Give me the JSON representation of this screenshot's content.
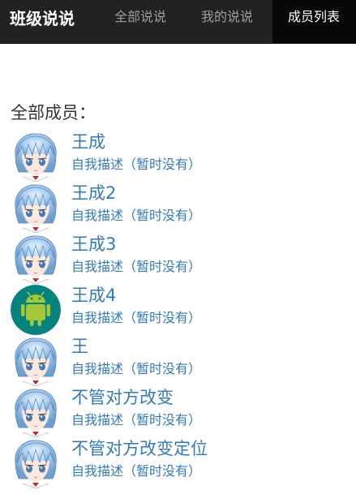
{
  "navbar": {
    "brand": "班级说说",
    "tabs": [
      {
        "label": "全部说说",
        "active": false
      },
      {
        "label": "我的说说",
        "active": false
      },
      {
        "label": "成员列表",
        "active": true
      }
    ]
  },
  "main": {
    "title": "全部成员：",
    "members": [
      {
        "name": "王成",
        "desc": "自我描述（暂时没有）",
        "avatar": "anime-avatar"
      },
      {
        "name": "王成2",
        "desc": "自我描述（暂时没有）",
        "avatar": "anime-avatar"
      },
      {
        "name": "王成3",
        "desc": "自我描述（暂时没有）",
        "avatar": "anime-avatar"
      },
      {
        "name": "王成4",
        "desc": "自我描述（暂时没有）",
        "avatar": "android-avatar"
      },
      {
        "name": "王",
        "desc": "自我描述（暂时没有）",
        "avatar": "anime-avatar"
      },
      {
        "name": "不管对方改变",
        "desc": "自我描述（暂时没有）",
        "avatar": "anime-avatar"
      },
      {
        "name": "不管对方改变定位",
        "desc": "自我描述（暂时没有）",
        "avatar": "anime-avatar"
      }
    ]
  },
  "colors": {
    "navbar_bg": "#222222",
    "link": "#337ab7",
    "android_bg": "#07837e",
    "android_green": "#a4c639"
  }
}
